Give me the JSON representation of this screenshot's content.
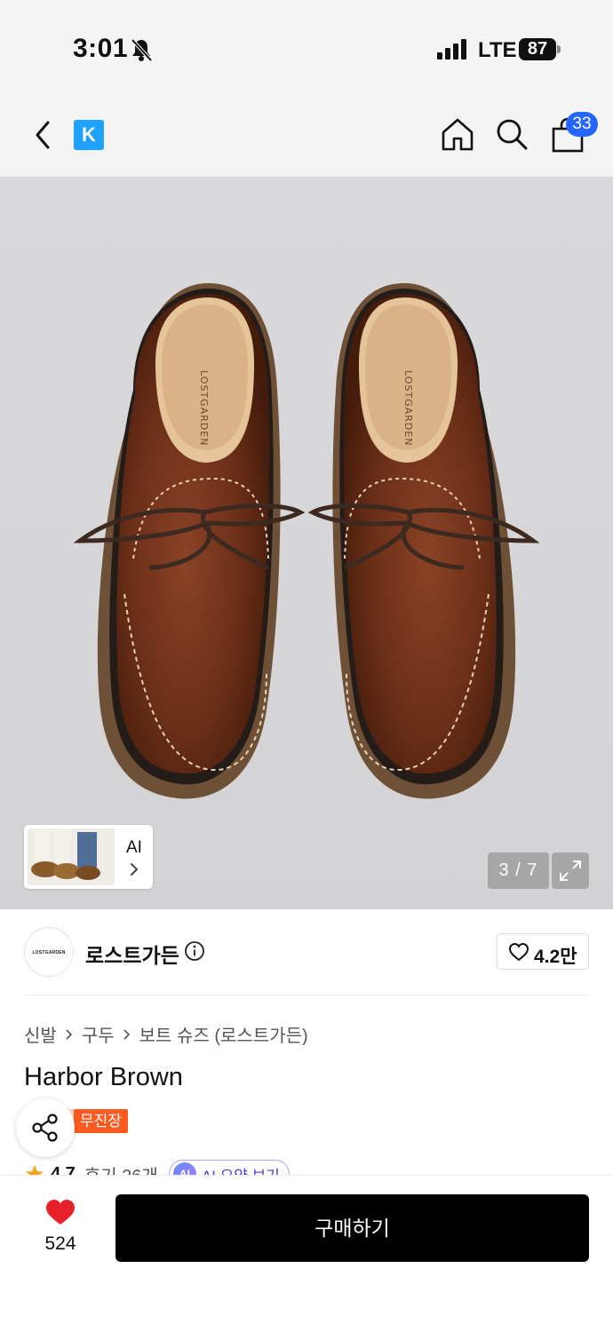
{
  "status_bar": {
    "time": "3:01",
    "network": "LTE",
    "battery": "87"
  },
  "nav": {
    "logo_letter": "K",
    "cart_count": "33",
    "icons": [
      "back-icon",
      "home-icon",
      "search-icon",
      "bag-icon"
    ]
  },
  "gallery": {
    "counter": "3 / 7",
    "ai_label": "AI"
  },
  "brand": {
    "name": "로스트가든",
    "logo_text": "LOSTGARDEN",
    "likes": "4.2만"
  },
  "breadcrumb": [
    "신발",
    "구두",
    "보트 슈즈 (로스트가든)"
  ],
  "product": {
    "title": "Harbor Brown",
    "badge": "무진장"
  },
  "rating": {
    "score": "4.7",
    "reviews": "후기 26개",
    "ai_summary": "AI 요약 보기",
    "ai_badge": "AI"
  },
  "bottom": {
    "like_count": "524",
    "buy_label": "구매하기"
  },
  "colors": {
    "accent_blue": "#2466ff",
    "logo_blue": "#1fa1ff",
    "badge_orange": "#ff5a1f",
    "heart_red": "#e8202a",
    "buy_black": "#000000"
  }
}
